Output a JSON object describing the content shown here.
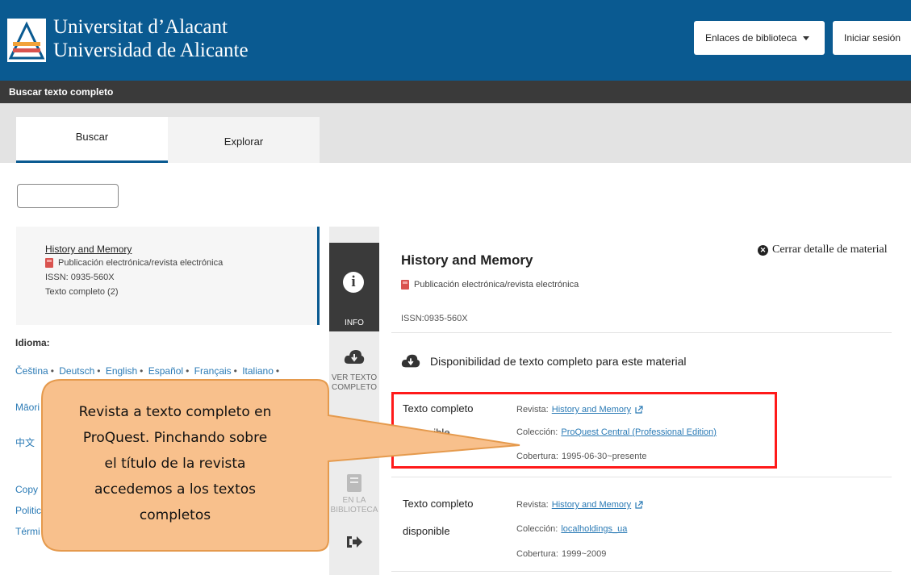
{
  "header": {
    "univ_line1": "Universitat d’Alacant",
    "univ_line2": "Universidad de Alicante",
    "links_button": "Enlaces de biblioteca",
    "login_button": "Iniciar sesión"
  },
  "toolbar": {
    "title": "Buscar texto completo"
  },
  "tabs": [
    {
      "label": "Buscar"
    },
    {
      "label": "Explorar"
    }
  ],
  "search": {
    "value": ""
  },
  "result": {
    "title": "History and Memory",
    "type": "Publicación electrónica/revista electrónica",
    "issn": "ISSN: 0935-560X",
    "fulltext": "Texto completo (2)"
  },
  "facets": {
    "label": "Idioma:",
    "langs_row1": [
      "Čeština",
      "Deutsch",
      "English",
      "Español",
      "Français",
      "Italiano"
    ],
    "lang_row2": "Māori",
    "lang_row3": "中文",
    "footer": [
      "Copy",
      "Politic",
      "Térmi"
    ]
  },
  "side_icons": {
    "info": "INFO",
    "fulltext_l1": "VER TEXTO",
    "fulltext_l2": "COMPLETO",
    "library_l1": "EN LA",
    "library_l2": "BIBLIOTECA"
  },
  "detail": {
    "close": "Cerrar detalle de material",
    "title": "History and Memory",
    "type": "Publicación electrónica/revista electrónica",
    "issn": "ISSN:0935-560X",
    "availability_heading": "Disponibilidad de texto completo para este material",
    "entries": [
      {
        "label_l1": "Texto completo",
        "label_l2": "disponible",
        "journal_key": "Revista:",
        "journal": "History and Memory",
        "collection_key": "Colección:",
        "collection": "ProQuest Central (Professional Edition)",
        "coverage_key": "Cobertura:",
        "coverage": "1995-06-30~presente"
      },
      {
        "label_l1": "Texto completo",
        "label_l2": "disponible",
        "journal_key": "Revista:",
        "journal": "History and Memory",
        "collection_key": "Colección:",
        "collection": "localholdings_ua",
        "coverage_key": "Cobertura:",
        "coverage": "1999~2009"
      }
    ]
  },
  "callout": {
    "lines": [
      "Revista a texto completo en",
      "ProQuest. Pinchando sobre",
      "el título de la revista",
      "accedemos a los textos",
      "completos"
    ]
  },
  "colors": {
    "header_bg": "#0a5a91",
    "toolbar_bg": "#3a3a3a",
    "callout_fill": "#f8c08c",
    "callout_stroke": "#e59a4d",
    "highlight": "#ff1a1a",
    "link": "#2a7ab5"
  }
}
